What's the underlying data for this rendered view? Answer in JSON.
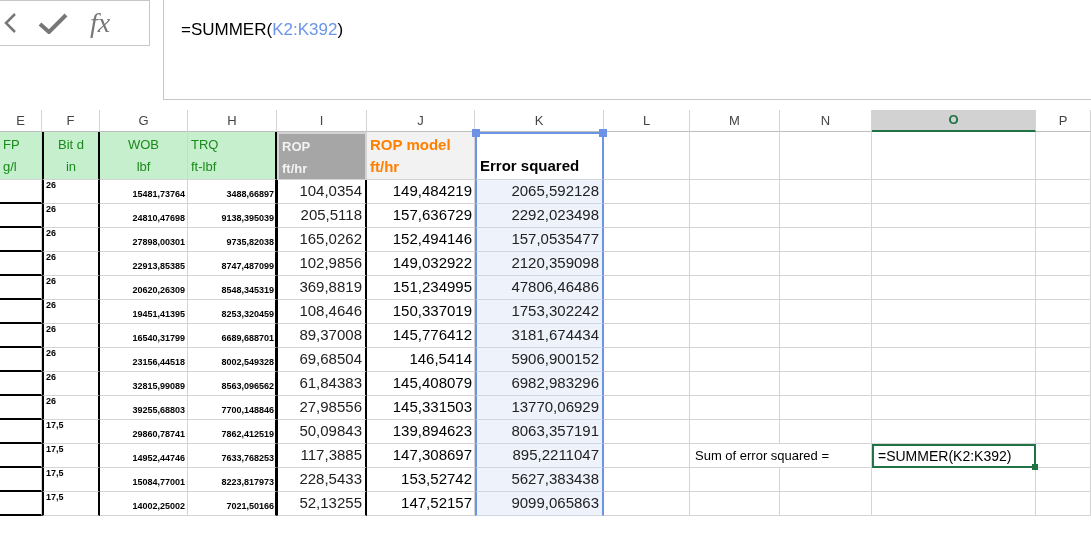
{
  "formula_bar": {
    "fx_label": "fx",
    "formula": [
      {
        "text": "=SUMMER(",
        "kind": "plain"
      },
      {
        "text": "K2:K392",
        "kind": "ref"
      },
      {
        "text": ")",
        "kind": "plain"
      }
    ]
  },
  "columns": [
    {
      "label": "E",
      "selected": false
    },
    {
      "label": "F",
      "selected": false
    },
    {
      "label": "G",
      "selected": false
    },
    {
      "label": "H",
      "selected": false
    },
    {
      "label": "I",
      "selected": false
    },
    {
      "label": "J",
      "selected": false
    },
    {
      "label": "K",
      "selected": false
    },
    {
      "label": "L",
      "selected": false
    },
    {
      "label": "M",
      "selected": false
    },
    {
      "label": "N",
      "selected": false
    },
    {
      "label": "O",
      "selected": true
    },
    {
      "label": "P",
      "selected": false
    }
  ],
  "headers": [
    {
      "kind": "green",
      "lines": [
        "FP",
        "g/l"
      ]
    },
    {
      "kind": "green",
      "lines": [
        "Bit d",
        "in"
      ]
    },
    {
      "kind": "green",
      "lines": [
        "WOB",
        "lbf"
      ]
    },
    {
      "kind": "green",
      "lines": [
        "TRQ",
        "ft-lbf"
      ]
    },
    {
      "kind": "dark",
      "lines": [
        "ROP",
        "ft/hr"
      ]
    },
    {
      "kind": "orange",
      "lines": [
        "ROP model",
        "ft/hr"
      ]
    },
    {
      "kind": "plain",
      "lines": [
        "Error squared"
      ]
    }
  ],
  "rows": [
    {
      "cells": [
        "26",
        "15481,73764",
        "3488,66897",
        "104,0354",
        "149,484219",
        "2065,592128"
      ]
    },
    {
      "cells": [
        "26",
        "24810,47698",
        "9138,395039",
        "205,5118",
        "157,636729",
        "2292,023498"
      ]
    },
    {
      "cells": [
        "26",
        "27898,00301",
        "9735,82038",
        "165,0262",
        "152,494146",
        "157,0535477"
      ]
    },
    {
      "cells": [
        "26",
        "22913,85385",
        "8747,487099",
        "102,9856",
        "149,032922",
        "2120,359098"
      ]
    },
    {
      "cells": [
        "26",
        "20620,26309",
        "8548,345319",
        "369,8819",
        "151,234995",
        "47806,46486"
      ]
    },
    {
      "cells": [
        "26",
        "19451,41395",
        "8253,320459",
        "108,4646",
        "150,337019",
        "1753,302242"
      ]
    },
    {
      "cells": [
        "26",
        "16540,31799",
        "6689,688701",
        "89,37008",
        "145,776412",
        "3181,674434"
      ]
    },
    {
      "cells": [
        "26",
        "23156,44518",
        "8002,549328",
        "69,68504",
        "146,5414",
        "5906,900152"
      ]
    },
    {
      "cells": [
        "26",
        "32815,99089",
        "8563,096562",
        "61,84383",
        "145,408079",
        "6982,983296"
      ]
    },
    {
      "cells": [
        "26",
        "39255,68803",
        "7700,148846",
        "27,98556",
        "145,331503",
        "13770,06929"
      ]
    },
    {
      "cells": [
        "17,5",
        "29860,78741",
        "7862,412519",
        "50,09843",
        "139,894623",
        "8063,357191"
      ]
    },
    {
      "cells": [
        "17,5",
        "14952,44746",
        "7633,768253",
        "117,3885",
        "147,308697",
        "895,2211047"
      ],
      "note": {
        "label": "Sum of error squared =",
        "formula": "=SUMMER(K2:K392)",
        "selected": true
      }
    },
    {
      "cells": [
        "17,5",
        "15084,77001",
        "8223,817973",
        "228,5433",
        "153,52742",
        "5627,383438"
      ]
    },
    {
      "cells": [
        "17,5",
        "14002,25002",
        "7021,50166",
        "52,13255",
        "147,52157",
        "9099,065863"
      ]
    }
  ]
}
